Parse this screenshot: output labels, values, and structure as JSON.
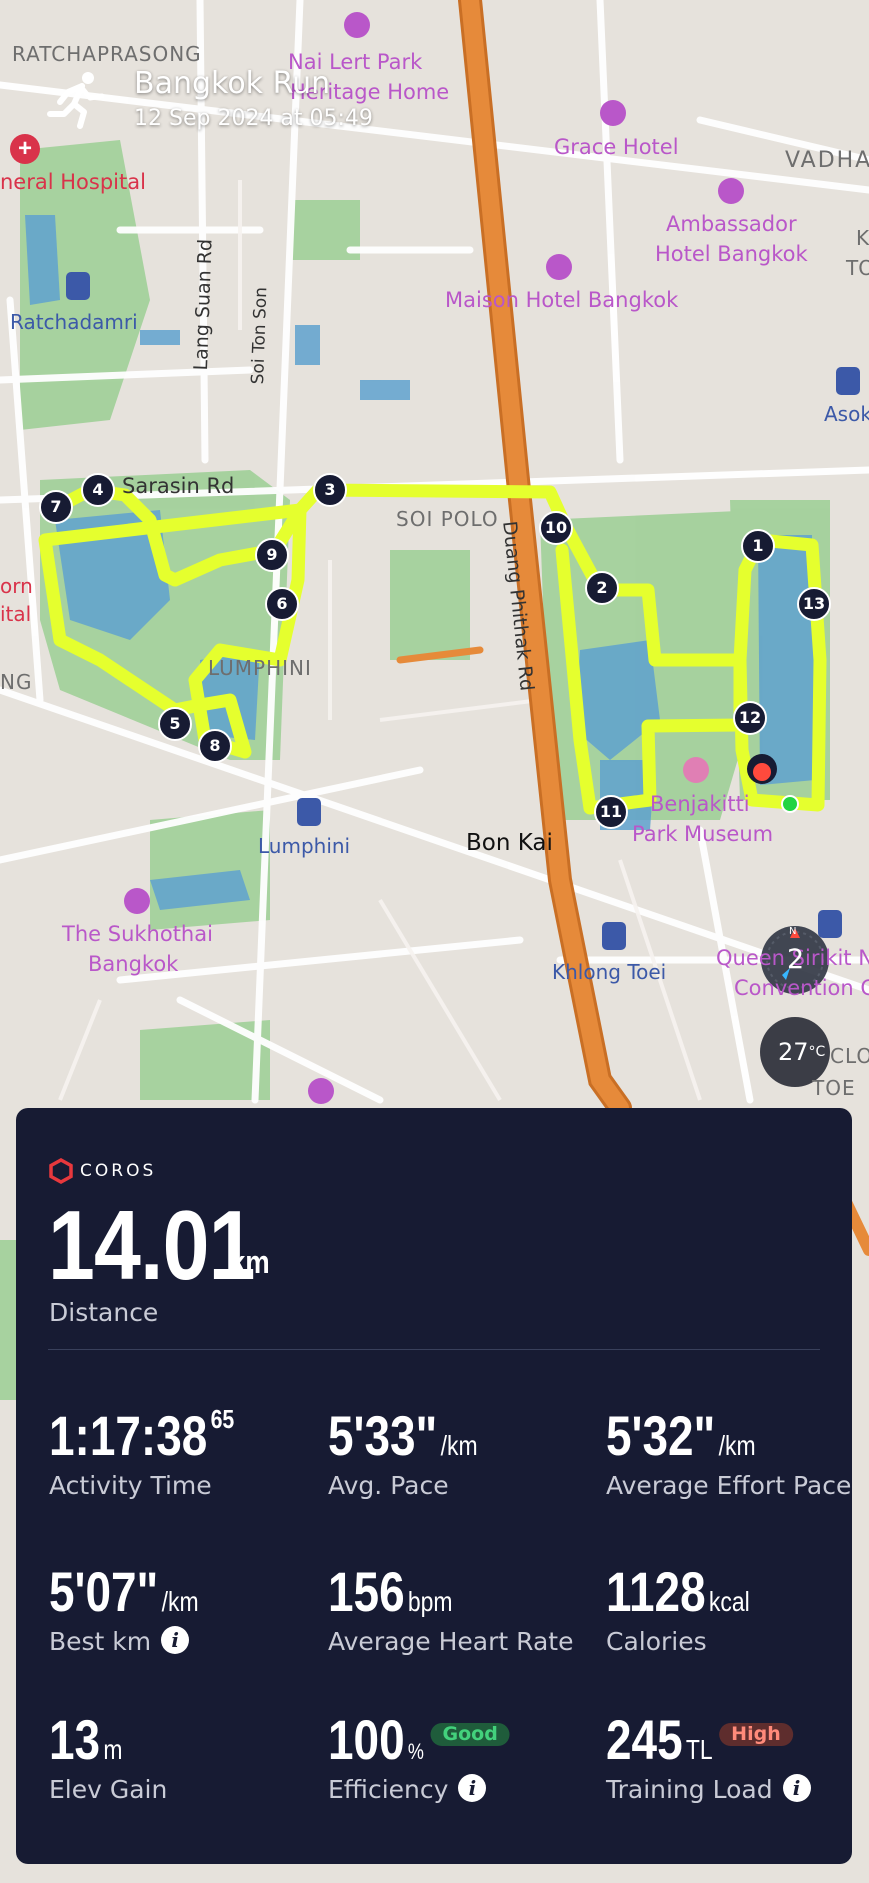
{
  "activity": {
    "title": "Bangkok Run",
    "datetime": "12 Sep 2024 at 05:49",
    "icon": "running-person-icon"
  },
  "map": {
    "place_labels": [
      {
        "id": "ratchaprasong",
        "text": "RATCHAPRASONG",
        "kind": "district"
      },
      {
        "id": "nai-lert-1",
        "text": "Nai Lert Park",
        "kind": "poi"
      },
      {
        "id": "nai-lert-2",
        "text": "Heritage Home",
        "kind": "poi"
      },
      {
        "id": "grace",
        "text": "Grace Hotel",
        "kind": "hotel"
      },
      {
        "id": "vadha",
        "text": "VADHA",
        "kind": "district"
      },
      {
        "id": "general-hospital",
        "text": "neral Hospital",
        "kind": "hospital"
      },
      {
        "id": "ambassador-1",
        "text": "Ambassador",
        "kind": "hotel"
      },
      {
        "id": "ambassador-2",
        "text": "Hotel Bangkok",
        "kind": "hotel"
      },
      {
        "id": "maison",
        "text": "Maison Hotel Bangkok",
        "kind": "hotel"
      },
      {
        "id": "ratchadamri",
        "text": "Ratchadamri",
        "kind": "transit"
      },
      {
        "id": "asok",
        "text": "Asok",
        "kind": "transit"
      },
      {
        "id": "sarasin",
        "text": "Sarasin Rd",
        "kind": "road"
      },
      {
        "id": "soi-polo",
        "text": "SOI POLO",
        "kind": "district"
      },
      {
        "id": "lumphini-area",
        "text": "LUMPHINI",
        "kind": "district"
      },
      {
        "id": "duang-phithak",
        "text": "Duang Phithak Rd",
        "kind": "road"
      },
      {
        "id": "lang-suan",
        "text": "Lang Suan Rd",
        "kind": "road"
      },
      {
        "id": "soi-ton-son",
        "text": "Soi Ton Son",
        "kind": "road"
      },
      {
        "id": "lumphini-station",
        "text": "Lumphini",
        "kind": "transit"
      },
      {
        "id": "bon-kai",
        "text": "Bon Kai",
        "kind": "neighborhood"
      },
      {
        "id": "benjakitti",
        "text": "Benjakitti",
        "kind": "poi"
      },
      {
        "id": "park-museum",
        "text": "Park Museum",
        "kind": "poi"
      },
      {
        "id": "sukhothai-1",
        "text": "The Sukhothai",
        "kind": "hotel"
      },
      {
        "id": "sukhothai-2",
        "text": "Bangkok",
        "kind": "hotel"
      },
      {
        "id": "khlong-toei",
        "text": "Khlong Toei",
        "kind": "transit"
      },
      {
        "id": "queen-sirikit-1",
        "text": "Queen Sirikit N",
        "kind": "poi"
      },
      {
        "id": "queen-sirikit-2",
        "text": "Convention C",
        "kind": "poi"
      },
      {
        "id": "orn",
        "text": "orn",
        "kind": "hospital"
      },
      {
        "id": "ital",
        "text": "ital",
        "kind": "hospital"
      },
      {
        "id": "ng",
        "text": "NG",
        "kind": "district"
      },
      {
        "id": "kh-clo",
        "text": "CLO",
        "kind": "district"
      },
      {
        "id": "toe",
        "text": "TOE",
        "kind": "district"
      },
      {
        "id": "k-right",
        "text": "K",
        "kind": "district"
      },
      {
        "id": "to-right",
        "text": "TO",
        "kind": "district"
      }
    ],
    "km_markers": [
      "1",
      "2",
      "3",
      "4",
      "5",
      "6",
      "7",
      "8",
      "9",
      "10",
      "11",
      "12",
      "13"
    ],
    "compass": {
      "label": "N",
      "value": "2"
    },
    "temperature": {
      "value": "27",
      "unit": "°C"
    }
  },
  "colors": {
    "route": "#e5ff2e",
    "panel_bg": "#171b33",
    "park": "#8fc48f",
    "water": "#5fa2cf",
    "main_road": "#d97c2c",
    "poi_text": "#b957c9",
    "transit_text": "#3c59a8",
    "hospital_text": "#d9334a",
    "good": "#43d17c",
    "high": "#ff8a7a"
  },
  "summary": {
    "brand": "COROS",
    "distance": {
      "value": "14.01",
      "unit": "km",
      "label": "Distance"
    }
  },
  "stats": {
    "activity_time": {
      "value": "1:17:38",
      "decimal": "65",
      "label": "Activity Time"
    },
    "avg_pace": {
      "value": "5'33\"",
      "unit": "/km",
      "label": "Avg. Pace"
    },
    "avg_effort_pace": {
      "value": "5'32\"",
      "unit": "/km",
      "label": "Average Effort Pace"
    },
    "best_km": {
      "value": "5'07\"",
      "unit": "/km",
      "label": "Best km"
    },
    "avg_hr": {
      "value": "156",
      "unit": "bpm",
      "label": "Average Heart Rate"
    },
    "calories": {
      "value": "1128",
      "unit": "kcal",
      "label": "Calories"
    },
    "elev_gain": {
      "value": "13",
      "unit": "m",
      "label": "Elev Gain"
    },
    "efficiency": {
      "value": "100",
      "unit": "%",
      "badge": "Good",
      "label": "Efficiency"
    },
    "training_load": {
      "value": "245",
      "unit": "TL",
      "badge": "High",
      "label": "Training Load"
    }
  }
}
